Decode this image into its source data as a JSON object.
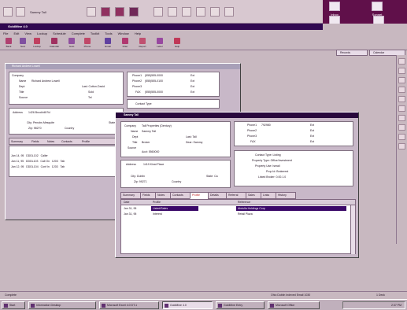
{
  "top_toolbar": {
    "current_record": "Sammy Tall",
    "icons": [
      "contact-icon",
      "back-icon",
      "forward-icon",
      "schedule-icon",
      "phone-icon",
      "write-icon",
      "history-icon",
      "notes-icon",
      "lookup-icon",
      "calendar-icon",
      "task-icon",
      "report-icon"
    ]
  },
  "desktop_icons": [
    "Inbox",
    "Sonnet",
    "HotDocs",
    "Word",
    "Office",
    "Calculator"
  ],
  "window": {
    "title": "GoldMine 4.0",
    "menu": [
      "File",
      "Edit",
      "View",
      "Lookup",
      "Schedule",
      "Complete",
      "Toolkit",
      "Tools",
      "Window",
      "Help"
    ],
    "toolbar": [
      "Back",
      "Next",
      "Lookup",
      "Calendar",
      "Goto",
      "Phone",
      "Email",
      "Filter",
      "Report",
      "Letter",
      "Help"
    ],
    "right_tabs": [
      "Records",
      "Calendar"
    ]
  },
  "bg_record": {
    "title": "Richard Andrew Lowell",
    "fields": [
      {
        "label": "Company",
        "value": ""
      },
      {
        "label": "Name",
        "value": "Richard Andrew Lowell"
      },
      {
        "label": "Dept",
        "value": "Last: Cotton-David"
      },
      {
        "label": "Title",
        "value": "Sold"
      },
      {
        "label": "Source",
        "value": "Tel"
      }
    ],
    "phones": [
      {
        "label": "Phone1",
        "value": "(555)555-0000",
        "ext": "Ext"
      },
      {
        "label": "Phone2",
        "value": "(555)555-0100",
        "ext": "Ext"
      },
      {
        "label": "Phone3",
        "value": "",
        "ext": "Ext"
      },
      {
        "label": "FAX",
        "value": "(555)555-0000",
        "ext": "Ext"
      }
    ],
    "address": {
      "label": "Address",
      "value": "1426 Brookhill Rd",
      "city": "City: Penobs Mesquite",
      "state": "State",
      "zip": "Zip: 98270",
      "country": "Country"
    },
    "contact_type": "Contact Type",
    "tabs": [
      "Summary",
      "Fields",
      "Notes",
      "Contacts",
      "Profile"
    ],
    "rows": [
      [
        "Jan 14, 95",
        "DDDL102",
        "Caller",
        "",
        ""
      ],
      [
        "Jan 11, 95",
        "DDDL103",
        "Call On",
        "1203",
        "Tab"
      ],
      [
        "Jan 12, 95",
        "DDDL104",
        "Conf In",
        "1203",
        "Tab"
      ]
    ]
  },
  "front_record": {
    "title": "Sammy Tall",
    "fields": [
      {
        "label": "Company",
        "value": "Tall Properties (Dentury)"
      },
      {
        "label": "Name",
        "value": "Sammy Tall"
      },
      {
        "label": "Dept",
        "value": "Last: Tall"
      },
      {
        "label": "Title",
        "value": "Broker"
      },
      {
        "label": "Source",
        "value": "Dear: Sammy"
      }
    ],
    "extra_line": "Acct: 5560000",
    "phones": [
      {
        "label": "Phone1",
        "value": "792980",
        "ext": "Ext"
      },
      {
        "label": "Phone2",
        "value": "",
        "ext": "Ext"
      },
      {
        "label": "Phone3",
        "value": "",
        "ext": "Ext"
      },
      {
        "label": "FAX",
        "value": "",
        "ext": "Ext"
      }
    ],
    "address": {
      "label": "Address",
      "value": "1419 Kinst Place",
      "city": "City: Dublin",
      "state": "State: Ca",
      "zip": "Zip: 99271",
      "country": "Country"
    },
    "contact_info": [
      "Contact Type: Listing",
      "Property Type: Office/Investment",
      "Property Use: Ismail",
      "Prop Id: Brokerest",
      "Listed Broker: 0.00.1.0"
    ],
    "tabs": [
      "Summary",
      "Fields",
      "Notes",
      "Contacts",
      "Profile",
      "Details",
      "Referral",
      "Sales",
      "Links",
      "History"
    ],
    "active_tab": "Profile",
    "grid_headers": [
      "Date",
      "Profile",
      "Reference"
    ],
    "grid_rows": [
      {
        "date": "Jan 31, 95",
        "profile": "Listed/Sales",
        "reference": "Abdulla Holdings Corp",
        "selected": true
      },
      {
        "date": "Jan 31, 95",
        "profile": "Interest",
        "reference": "Retail Plaza",
        "selected": false
      }
    ]
  },
  "status_bar": {
    "left": "Complete",
    "middle": "Ohio Dublin  Indexed Email 1030",
    "right": "1 Deck"
  },
  "taskbar": {
    "items": [
      "Start",
      "Information Desktop",
      "Microsoft Excel 4.0 DT-1",
      "GoldMine 4.0",
      "GoldMine Entry",
      "Microsoft Office"
    ],
    "active": "GoldMine 4.0",
    "clock": "2:37 PM"
  }
}
